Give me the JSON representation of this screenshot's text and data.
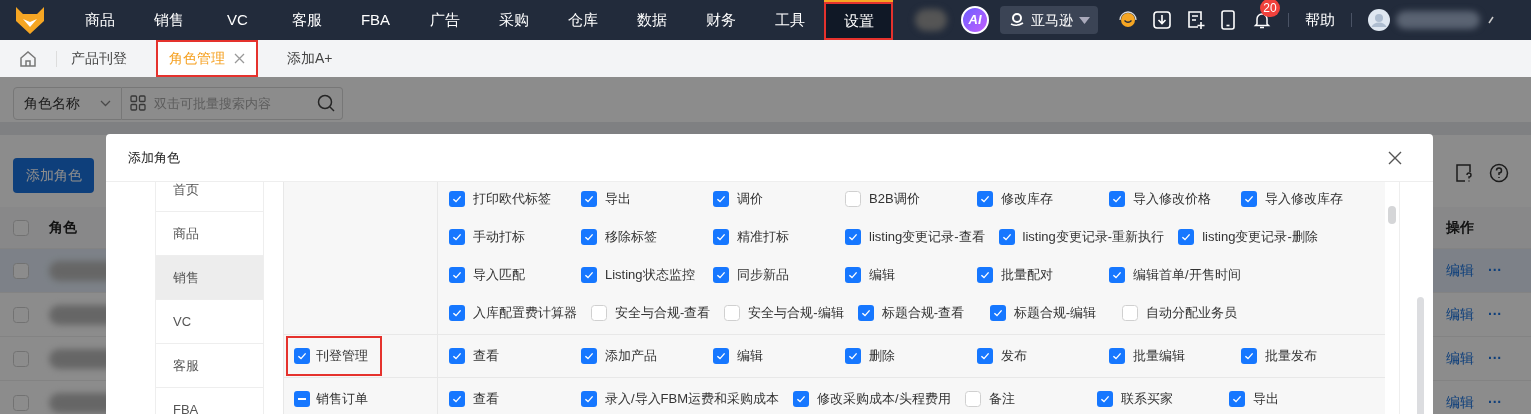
{
  "nav": {
    "items": [
      {
        "label": "商品",
        "selected": false,
        "annotated": false
      },
      {
        "label": "销售",
        "selected": false,
        "annotated": false
      },
      {
        "label": "VC",
        "selected": false,
        "annotated": false
      },
      {
        "label": "客服",
        "selected": false,
        "annotated": false
      },
      {
        "label": "FBA",
        "selected": false,
        "annotated": false
      },
      {
        "label": "广告",
        "selected": false,
        "annotated": false
      },
      {
        "label": "采购",
        "selected": false,
        "annotated": false
      },
      {
        "label": "仓库",
        "selected": false,
        "annotated": false
      },
      {
        "label": "数据",
        "selected": false,
        "annotated": false
      },
      {
        "label": "财务",
        "selected": false,
        "annotated": false
      },
      {
        "label": "工具",
        "selected": false,
        "annotated": false
      },
      {
        "label": "设置",
        "selected": true,
        "annotated": true
      }
    ],
    "ai_badge": "AI",
    "store": "亚马逊",
    "notification_count": "20",
    "help": "帮助"
  },
  "tabs": [
    {
      "label": "产品刊登",
      "selected": false,
      "closable": false,
      "annotated": false
    },
    {
      "label": "角色管理",
      "selected": true,
      "closable": true,
      "annotated": true
    },
    {
      "label": "添加A+",
      "selected": false,
      "closable": false,
      "annotated": false
    }
  ],
  "filter": {
    "field": "角色名称",
    "placeholder": "双击可批量搜索内容"
  },
  "add_button": "添加角色",
  "table": {
    "columns": [
      "角色",
      "操作"
    ],
    "header_checked": false,
    "rows": [
      {
        "highlighted": true,
        "checked": false,
        "action": "编辑",
        "more": "···"
      },
      {
        "highlighted": false,
        "checked": false,
        "action": "编辑",
        "more": "···"
      },
      {
        "highlighted": false,
        "checked": false,
        "action": "编辑",
        "more": "···"
      },
      {
        "highlighted": false,
        "checked": false,
        "action": "编辑",
        "more": "···"
      }
    ]
  },
  "modal": {
    "title": "添加角色",
    "menu": [
      {
        "label": "首页",
        "selected": false
      },
      {
        "label": "商品",
        "selected": false
      },
      {
        "label": "销售",
        "selected": true
      },
      {
        "label": "VC",
        "selected": false
      },
      {
        "label": "客服",
        "selected": false
      },
      {
        "label": "FBA",
        "selected": false
      }
    ],
    "permission_rows": [
      {
        "lines": [
          [
            {
              "label": "打印欧代标签",
              "checked": true
            },
            {
              "label": "导出",
              "checked": true
            },
            {
              "label": "调价",
              "checked": true
            },
            {
              "label": "B2B调价",
              "checked": false
            },
            {
              "label": "修改库存",
              "checked": true
            },
            {
              "label": "导入修改价格",
              "checked": true
            },
            {
              "label": "导入修改库存",
              "checked": true
            }
          ],
          [
            {
              "label": "手动打标",
              "checked": true
            },
            {
              "label": "移除标签",
              "checked": true
            },
            {
              "label": "精准打标",
              "checked": true
            },
            {
              "label": "listing变更记录-查看",
              "checked": true
            },
            {
              "label": "listing变更记录-重新执行",
              "checked": true
            },
            {
              "label": "listing变更记录-删除",
              "checked": true
            }
          ],
          [
            {
              "label": "导入匹配",
              "checked": true
            },
            {
              "label": "Listing状态监控",
              "checked": true
            },
            {
              "label": "同步新品",
              "checked": true
            },
            {
              "label": "编辑",
              "checked": true
            },
            {
              "label": "批量配对",
              "checked": true
            },
            {
              "label": "编辑首单/开售时间",
              "checked": true
            }
          ],
          [
            {
              "label": "入库配置费计算器",
              "checked": true
            },
            {
              "label": "安全与合规-查看",
              "checked": false
            },
            {
              "label": "安全与合规-编辑",
              "checked": false
            },
            {
              "label": "标题合规-查看",
              "checked": true
            },
            {
              "label": "标题合规-编辑",
              "checked": true
            },
            {
              "label": "自动分配业务员",
              "checked": false
            }
          ]
        ]
      },
      {
        "label": "刊登管理",
        "checked": true,
        "annotated": true,
        "lines": [
          [
            {
              "label": "查看",
              "checked": true
            },
            {
              "label": "添加产品",
              "checked": true
            },
            {
              "label": "编辑",
              "checked": true
            },
            {
              "label": "删除",
              "checked": true
            },
            {
              "label": "发布",
              "checked": true
            },
            {
              "label": "批量编辑",
              "checked": true
            },
            {
              "label": "批量发布",
              "checked": true
            }
          ]
        ]
      },
      {
        "label": "销售订单",
        "indeterminate": true,
        "annotated": false,
        "lines": [
          [
            {
              "label": "查看",
              "checked": true
            },
            {
              "label": "录入/导入FBM运费和采购成本",
              "checked": true
            },
            {
              "label": "修改采购成本/头程费用",
              "checked": true
            },
            {
              "label": "备注",
              "checked": false
            },
            {
              "label": "联系买家",
              "checked": true
            },
            {
              "label": "导出",
              "checked": true
            }
          ]
        ]
      }
    ]
  }
}
